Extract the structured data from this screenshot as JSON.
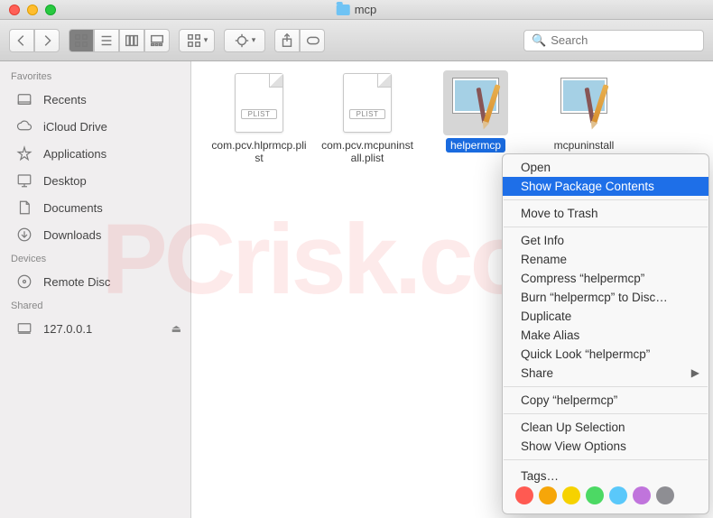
{
  "window": {
    "title": "mcp"
  },
  "toolbar": {
    "search_placeholder": "Search"
  },
  "sidebar": {
    "sections": [
      {
        "heading": "Favorites",
        "items": [
          {
            "icon": "recents",
            "label": "Recents"
          },
          {
            "icon": "icloud",
            "label": "iCloud Drive"
          },
          {
            "icon": "apps",
            "label": "Applications"
          },
          {
            "icon": "desktop",
            "label": "Desktop"
          },
          {
            "icon": "docs",
            "label": "Documents"
          },
          {
            "icon": "downloads",
            "label": "Downloads"
          }
        ]
      },
      {
        "heading": "Devices",
        "items": [
          {
            "icon": "disc",
            "label": "Remote Disc"
          }
        ]
      },
      {
        "heading": "Shared",
        "items": [
          {
            "icon": "computer",
            "label": "127.0.0.1",
            "eject": true
          }
        ]
      }
    ]
  },
  "files": [
    {
      "name": "com.pcv.hlprmcp.plist",
      "type": "plist",
      "selected": false
    },
    {
      "name": "com.pcv.mcpuninstall.plist",
      "type": "plist",
      "selected": false
    },
    {
      "name": "helpermcp",
      "type": "app",
      "selected": true
    },
    {
      "name": "mcpuninstall",
      "type": "app",
      "selected": false
    }
  ],
  "context_menu": {
    "items": [
      {
        "label": "Open"
      },
      {
        "label": "Show Package Contents",
        "highlighted": true
      },
      {
        "sep": true
      },
      {
        "label": "Move to Trash"
      },
      {
        "sep": true
      },
      {
        "label": "Get Info"
      },
      {
        "label": "Rename"
      },
      {
        "label": "Compress “helpermcp”"
      },
      {
        "label": "Burn “helpermcp” to Disc…"
      },
      {
        "label": "Duplicate"
      },
      {
        "label": "Make Alias"
      },
      {
        "label": "Quick Look “helpermcp”"
      },
      {
        "label": "Share",
        "submenu": true
      },
      {
        "sep": true
      },
      {
        "label": "Copy “helpermcp”"
      },
      {
        "sep": true
      },
      {
        "label": "Clean Up Selection"
      },
      {
        "label": "Show View Options"
      },
      {
        "sep": true
      },
      {
        "label": "Tags…",
        "tags": true
      }
    ],
    "tag_colors": [
      "#ff5a52",
      "#f6a609",
      "#f6d200",
      "#4cd964",
      "#5ac8fa",
      "#c074dc",
      "#8e8e93"
    ]
  },
  "watermark": "PCrisk.com"
}
